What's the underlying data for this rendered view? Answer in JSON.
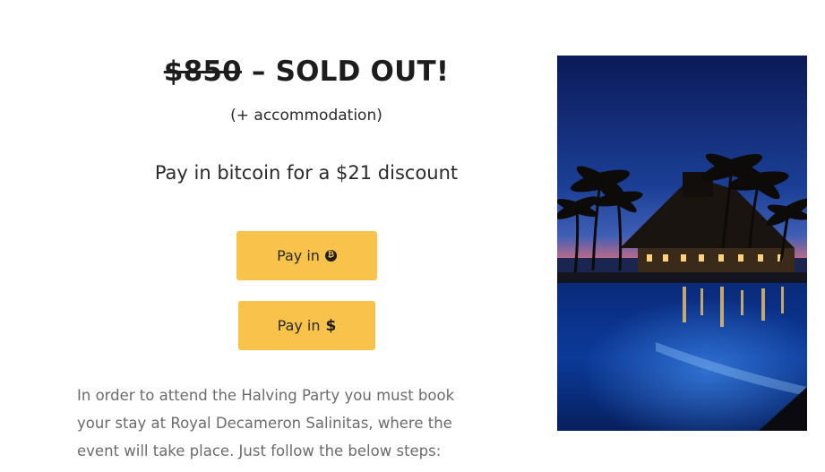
{
  "pricing": {
    "old_price": "$850",
    "sold_out_text": " – SOLD OUT!",
    "accommodation_note": "(+ accommodation)",
    "bitcoin_discount": "Pay in bitcoin for a $21 discount"
  },
  "buttons": {
    "pay_btc_label": "Pay in",
    "pay_btc_icon": "bitcoin-icon",
    "pay_usd_label": "Pay in",
    "pay_usd_icon": "dollar-icon"
  },
  "description": {
    "line1": "In order to attend the Halving Party you must book",
    "line2": "your stay at Royal Decameron Salinitas, where the",
    "line3": "event will take place. Just follow the below steps:"
  },
  "photo": {
    "subject": "resort-pool-at-dusk-image"
  },
  "colors": {
    "button_bg": "#f8c24b",
    "heading_text": "#1d1d1d",
    "body_text": "#6b6b6b"
  }
}
